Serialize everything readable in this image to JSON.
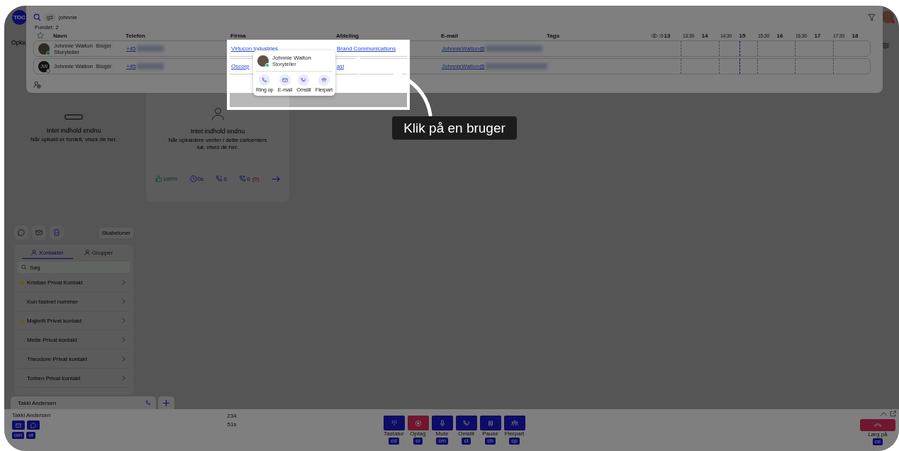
{
  "app_badge": "TOC",
  "search": {
    "scope": "g5",
    "value": "johnnie",
    "found": "Fundet: 2",
    "columns": [
      "Navn",
      "Telefon",
      "Firma",
      "Afdeling",
      "E-mail",
      "Tags"
    ],
    "visible_count": ":0",
    "hours": [
      "13",
      "13:30",
      "14",
      "14:30",
      "15",
      "15:30",
      "16",
      "16:30",
      "17",
      "17:30",
      "18"
    ],
    "results": [
      {
        "online": true,
        "name": "Johnnie Walton",
        "badge": "Bruger",
        "title": "Storyteller",
        "phone": "+45",
        "company": "Virtucon Industries",
        "department": "Brand Communications",
        "email": "JohnnieWalton@"
      },
      {
        "initials": "JW",
        "online": false,
        "name": "Johnnie Walton",
        "badge": "Bruger",
        "phone": "+45",
        "company": "Oscorp",
        "department": "asi",
        "email": "JohnnieWalton@"
      }
    ],
    "popup": {
      "name": "Johnnie Walton",
      "title": "Storyteller",
      "online": true,
      "actions": [
        {
          "kind": "call",
          "label": "Ring op"
        },
        {
          "kind": "email",
          "label": "E-mail"
        },
        {
          "kind": "transfer",
          "label": "Omstil"
        },
        {
          "kind": "conference",
          "label": "Flerpart"
        }
      ]
    }
  },
  "tutorial": {
    "callout": "Klik på en bruger"
  },
  "side_label": "Opka",
  "queues": [
    {
      "title": "Intet indhold endnu",
      "text": "Når opkald er fordelt, vises de her."
    },
    {
      "title": "Intet indhold endnu",
      "text": "Når opkaldere venter i dette callcenters kø, vises de her.",
      "stats": {
        "answer_rate": "100%",
        "wait": "0s",
        "waiting": "0",
        "missed": "0",
        "missed_extra": "(0)"
      }
    }
  ],
  "templates_button": "Skabeloner",
  "contacts": {
    "tabs": [
      {
        "label": "Kontakter",
        "selected": true
      },
      {
        "label": "Grupper",
        "selected": false
      }
    ],
    "search_placeholder": "Søg",
    "items": [
      {
        "name": "Kristian Privat Kontakt",
        "favorite": true
      },
      {
        "name": "Kun fastnet nummer",
        "favorite": false
      },
      {
        "name": "Majbritt Privat kontakt",
        "favorite": true
      },
      {
        "name": "Mette Privat kontakt",
        "favorite": false
      },
      {
        "name": "Theodore Privat kontakt",
        "favorite": false
      },
      {
        "name": "Torben Privat kontakt",
        "favorite": false
      }
    ]
  },
  "call_tab": "Takki Andersen",
  "call": {
    "name": "Takki Andersen",
    "shortcuts": [
      "om",
      "ot"
    ],
    "number": "234",
    "duration": "51s",
    "controls": [
      {
        "kind": "keypad",
        "label": "Tastatur",
        "key": "cd"
      },
      {
        "kind": "record",
        "label": "Optag",
        "key": "cr"
      },
      {
        "kind": "mute",
        "label": "Mute",
        "key": "cm"
      },
      {
        "kind": "transfer",
        "label": "Omstil",
        "key": "ct"
      },
      {
        "kind": "pause",
        "label": "Pause",
        "key": "ch"
      },
      {
        "kind": "conference",
        "label": "Flerpart",
        "key": "cp"
      }
    ],
    "hangup": {
      "label": "Læg på",
      "key": "ce"
    }
  }
}
